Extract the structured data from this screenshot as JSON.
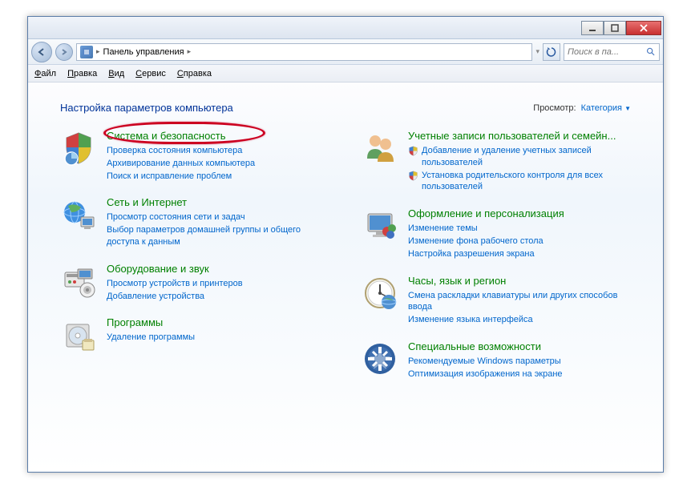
{
  "breadcrumb": {
    "root": "Панель управления"
  },
  "search": {
    "placeholder": "Поиск в па..."
  },
  "menu": {
    "file": "Файл",
    "edit": "Правка",
    "view": "Вид",
    "tools": "Сервис",
    "help": "Справка"
  },
  "header": {
    "title": "Настройка параметров компьютера",
    "view_label": "Просмотр:",
    "view_value": "Категория"
  },
  "left": [
    {
      "title": "Система и безопасность",
      "links": [
        {
          "text": "Проверка состояния компьютера"
        },
        {
          "text": "Архивирование данных компьютера"
        },
        {
          "text": "Поиск и исправление проблем"
        }
      ]
    },
    {
      "title": "Сеть и Интернет",
      "links": [
        {
          "text": "Просмотр состояния сети и задач"
        },
        {
          "text": "Выбор параметров домашней группы и общего доступа к данным"
        }
      ]
    },
    {
      "title": "Оборудование и звук",
      "links": [
        {
          "text": "Просмотр устройств и принтеров"
        },
        {
          "text": "Добавление устройства"
        }
      ]
    },
    {
      "title": "Программы",
      "links": [
        {
          "text": "Удаление программы"
        }
      ]
    }
  ],
  "right": [
    {
      "title": "Учетные записи пользователей и семейн...",
      "links": [
        {
          "text": "Добавление и удаление учетных записей пользователей",
          "shield": true
        },
        {
          "text": "Установка родительского контроля для всех пользователей",
          "shield": true
        }
      ]
    },
    {
      "title": "Оформление и персонализация",
      "links": [
        {
          "text": "Изменение темы"
        },
        {
          "text": "Изменение фона рабочего стола"
        },
        {
          "text": "Настройка разрешения экрана"
        }
      ]
    },
    {
      "title": "Часы, язык и регион",
      "links": [
        {
          "text": "Смена раскладки клавиатуры или других способов ввода"
        },
        {
          "text": "Изменение языка интерфейса"
        }
      ]
    },
    {
      "title": "Специальные возможности",
      "links": [
        {
          "text": "Рекомендуемые Windows параметры"
        },
        {
          "text": "Оптимизация изображения на экране"
        }
      ]
    }
  ]
}
